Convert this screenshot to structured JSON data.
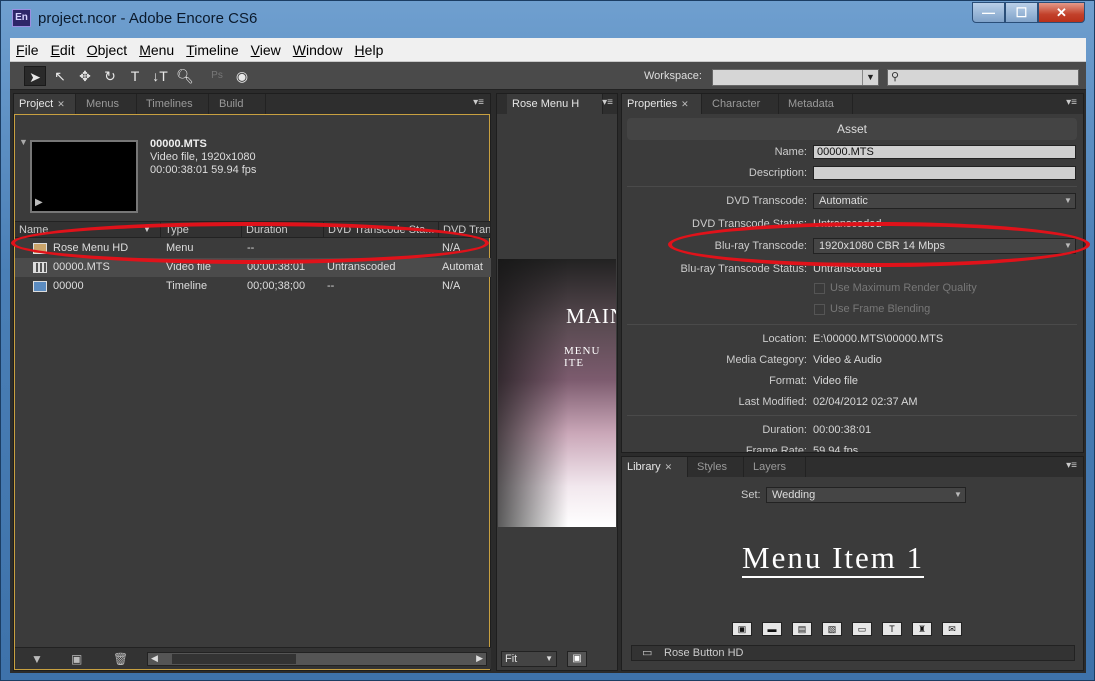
{
  "window": {
    "app_icon": "En",
    "title": "project.ncor - Adobe Encore CS6",
    "controls": {
      "minimize": "—",
      "maximize": "☐",
      "close": "✕"
    }
  },
  "menubar": [
    "File",
    "Edit",
    "Object",
    "Menu",
    "Timeline",
    "View",
    "Window",
    "Help"
  ],
  "toolbar": {
    "tools": [
      "selection-tool-icon",
      "direct-select-tool-icon",
      "move-tool-icon",
      "rotate-tool-icon",
      "text-tool-icon",
      "vertical-text-tool-icon",
      "zoom-tool-icon",
      "photoshop-icon",
      "preview-icon"
    ],
    "workspace_label": "Workspace:",
    "workspace_value": "",
    "search_placeholder": ""
  },
  "project_panel": {
    "tabs": [
      "Project",
      "Menus",
      "Timelines",
      "Build"
    ],
    "selected_file": {
      "name": "00000.MTS",
      "line1": "Video file, 1920x1080",
      "line2": "00:00:38:01 59.94 fps"
    },
    "columns": [
      "Name",
      "Type",
      "Duration",
      "DVD Transcode Sta...",
      "DVD Tran"
    ],
    "rows": [
      {
        "icon": "menu-icon",
        "name": "Rose Menu HD",
        "type": "Menu",
        "duration": "--",
        "status": "",
        "dvd": "N/A"
      },
      {
        "icon": "film-icon",
        "name": "00000.MTS",
        "type": "Video file",
        "duration": "00:00:38:01",
        "status": "Untranscoded",
        "dvd": "Automat"
      },
      {
        "icon": "timeline-icon",
        "name": "00000",
        "type": "Timeline",
        "duration": "00;00;38;00",
        "status": "--",
        "dvd": "N/A"
      }
    ]
  },
  "preview_panel": {
    "tab": "Rose Menu H",
    "title": "MAIN",
    "subtitle": "MENU ITE",
    "zoom": "Fit"
  },
  "properties_panel": {
    "tabs": [
      "Properties",
      "Character",
      "Metadata"
    ],
    "section": "Asset",
    "name_label": "Name:",
    "name_value": "00000.MTS",
    "description_label": "Description:",
    "description_value": "",
    "dvd_transcode_label": "DVD Transcode:",
    "dvd_transcode_value": "Automatic",
    "dvd_status_label": "DVD Transcode Status:",
    "dvd_status_value": "Untranscoded",
    "bluray_transcode_label": "Blu-ray Transcode:",
    "bluray_transcode_value": "1920x1080 CBR 14 Mbps",
    "bluray_status_label": "Blu-ray Transcode Status:",
    "bluray_status_value": "Untranscoded",
    "max_render_label": "Use Maximum Render Quality",
    "frame_blending_label": "Use Frame Blending",
    "location_label": "Location:",
    "location_value": "E:\\00000.MTS\\00000.MTS",
    "media_category_label": "Media Category:",
    "media_category_value": "Video & Audio",
    "format_label": "Format:",
    "format_value": "Video file",
    "last_modified_label": "Last Modified:",
    "last_modified_value": "02/04/2012 02:37 AM",
    "duration_label": "Duration:",
    "duration_value": "00:00:38:01",
    "frame_rate_label": "Frame Rate:",
    "frame_rate_value": "59.94 fps"
  },
  "library_panel": {
    "tabs": [
      "Library",
      "Styles",
      "Layers"
    ],
    "set_label": "Set:",
    "set_value": "Wedding",
    "preview_text": "Menu Item 1",
    "item_buttons": [
      "▣",
      "▬",
      "▤",
      "▧",
      "▭",
      "T",
      "♜",
      "✉"
    ],
    "list_item": "Rose Button HD"
  },
  "colors": {
    "panel_bg": "#3b3b3b",
    "highlight": "#e0121a",
    "accent_border": "#c8a040"
  }
}
